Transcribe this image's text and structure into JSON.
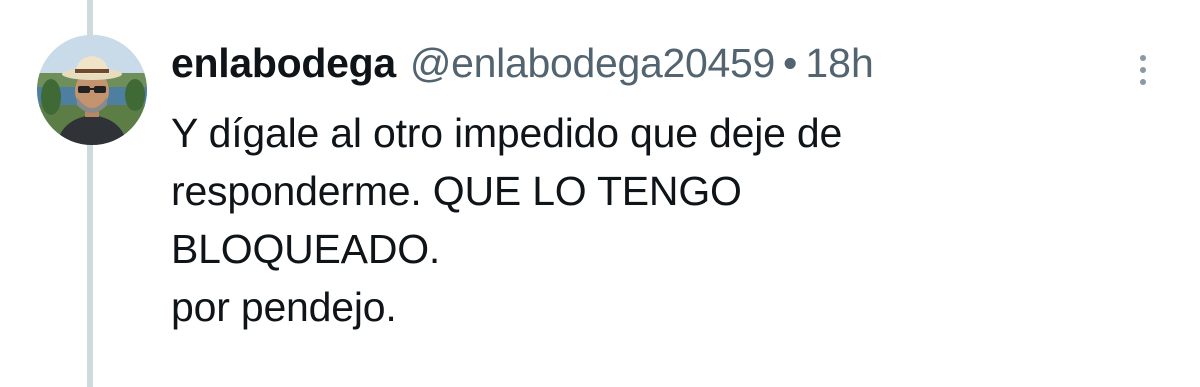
{
  "tweet": {
    "display_name": "enlabodega",
    "handle": "@enlabodega20459",
    "separator": "•",
    "timestamp": "18h",
    "lines": [
      "Y dígale al otro impedido que deje de",
      "responderme. QUE LO TENGO",
      "BLOQUEADO.",
      "por pendejo."
    ]
  },
  "icons": {
    "more": "more-vertical-icon",
    "avatar": "profile-photo"
  },
  "colors": {
    "text_primary": "#0f1419",
    "text_secondary": "#536471",
    "thread_line": "#cfd9de",
    "background": "#ffffff"
  }
}
